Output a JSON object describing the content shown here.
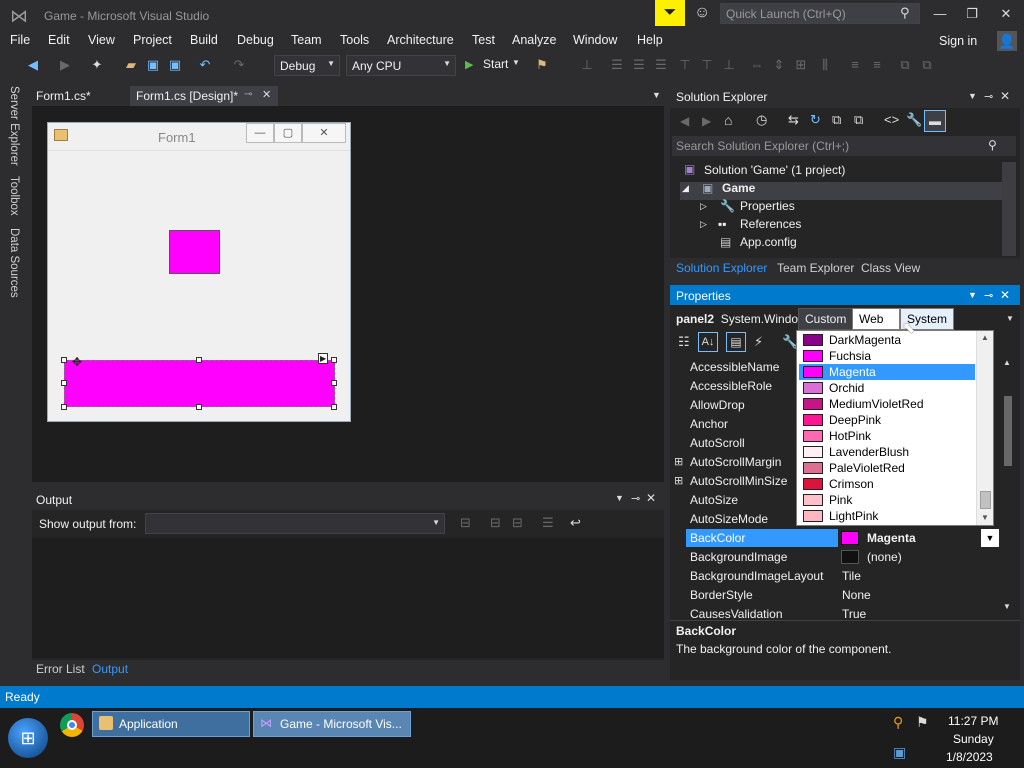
{
  "app": {
    "title": "Game - Microsoft Visual Studio",
    "quick_launch_placeholder": "Quick Launch (Ctrl+Q)",
    "sign_in": "Sign in"
  },
  "menu": [
    "File",
    "Edit",
    "View",
    "Project",
    "Build",
    "Debug",
    "Team",
    "Tools",
    "Architecture",
    "Test",
    "Analyze",
    "Window",
    "Help"
  ],
  "toolbar": {
    "config": "Debug",
    "platform": "Any CPU",
    "start": "Start"
  },
  "side_tabs": [
    "Server Explorer",
    "Toolbox",
    "Data Sources"
  ],
  "doc_tabs": [
    {
      "label": "Form1.cs*"
    },
    {
      "label": "Form1.cs [Design]*"
    }
  ],
  "form": {
    "title": "Form1",
    "panel1_color": "#ff00ff",
    "panel2_color": "#ff00ff"
  },
  "output": {
    "title": "Output",
    "show_output_from": "Show output from:"
  },
  "bottom_tabs": [
    "Error List",
    "Output"
  ],
  "solution_explorer": {
    "title": "Solution Explorer",
    "search_placeholder": "Search Solution Explorer (Ctrl+;)",
    "items": [
      {
        "label": "Solution 'Game' (1 project)"
      },
      {
        "label": "Game"
      },
      {
        "label": "Properties"
      },
      {
        "label": "References"
      },
      {
        "label": "App.config"
      }
    ],
    "tabs": [
      "Solution Explorer",
      "Team Explorer",
      "Class View"
    ]
  },
  "properties": {
    "title": "Properties",
    "object": "panel2",
    "object_type": "System.Windo",
    "rows": [
      {
        "name": "AccessibleName",
        "value": ""
      },
      {
        "name": "AccessibleRole",
        "value": ""
      },
      {
        "name": "AllowDrop",
        "value": ""
      },
      {
        "name": "Anchor",
        "value": ""
      },
      {
        "name": "AutoScroll",
        "value": ""
      },
      {
        "name": "AutoScrollMargin",
        "value": ""
      },
      {
        "name": "AutoScrollMinSize",
        "value": ""
      },
      {
        "name": "AutoSize",
        "value": ""
      },
      {
        "name": "AutoSizeMode",
        "value": ""
      },
      {
        "name": "BackColor",
        "value": "Magenta"
      },
      {
        "name": "BackgroundImage",
        "value": "(none)"
      },
      {
        "name": "BackgroundImageLayout",
        "value": "Tile"
      },
      {
        "name": "BorderStyle",
        "value": "None"
      },
      {
        "name": "CausesValidation",
        "value": "True"
      }
    ],
    "description_title": "BackColor",
    "description_text": "The background color of the component."
  },
  "color_picker": {
    "tabs": [
      "Custom",
      "Web",
      "System"
    ],
    "items": [
      {
        "name": "DarkMagenta",
        "color": "#8b008b"
      },
      {
        "name": "Fuchsia",
        "color": "#ff00ff"
      },
      {
        "name": "Magenta",
        "color": "#ff00ff"
      },
      {
        "name": "Orchid",
        "color": "#da70d6"
      },
      {
        "name": "MediumVioletRed",
        "color": "#c71585"
      },
      {
        "name": "DeepPink",
        "color": "#ff1493"
      },
      {
        "name": "HotPink",
        "color": "#ff69b4"
      },
      {
        "name": "LavenderBlush",
        "color": "#fff0f5"
      },
      {
        "name": "PaleVioletRed",
        "color": "#db7093"
      },
      {
        "name": "Crimson",
        "color": "#dc143c"
      },
      {
        "name": "Pink",
        "color": "#ffc0cb"
      },
      {
        "name": "LightPink",
        "color": "#ffb6c1"
      }
    ],
    "selected": "Magenta"
  },
  "status": "Ready",
  "taskbar": {
    "buttons": [
      "Application",
      "Game - Microsoft Vis..."
    ],
    "time": "11:27 PM",
    "day": "Sunday",
    "date": "1/8/2023"
  }
}
